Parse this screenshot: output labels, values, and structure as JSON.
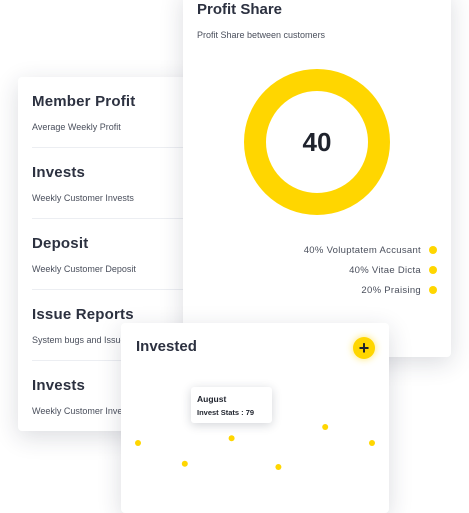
{
  "member_card": {
    "items": [
      {
        "title": "Member Profit",
        "subtitle": "Average Weekly Profit"
      },
      {
        "title": "Invests",
        "subtitle": "Weekly Customer Invests"
      },
      {
        "title": "Deposit",
        "subtitle": "Weekly Customer Deposit"
      },
      {
        "title": "Issue Reports",
        "subtitle": "System bugs and Issues"
      },
      {
        "title": "Invests",
        "subtitle": "Weekly Customer Invests"
      }
    ]
  },
  "profit_share": {
    "title": "Profit Share",
    "subtitle": "Profit Share between customers",
    "center_value": "40",
    "legend": [
      {
        "label": "40% Voluptatem Accusant",
        "color": "#ffd600"
      },
      {
        "label": "40% Vitae Dicta",
        "color": "#ffd600"
      },
      {
        "label": "20% Praising",
        "color": "#ffd600"
      }
    ],
    "donut_color": "#ffd600"
  },
  "invested": {
    "title": "Invested",
    "add_icon": "plus-icon",
    "add_label": "+",
    "tooltip": {
      "title": "August",
      "value": "Invest Stats : 79"
    }
  },
  "chart_data": {
    "type": "scatter",
    "title": "Invested",
    "x": [
      1,
      2,
      3,
      4,
      5,
      6
    ],
    "y": [
      45,
      32,
      48,
      30,
      55,
      45
    ],
    "highlight_index": 2,
    "point_color": "#ffd600"
  }
}
